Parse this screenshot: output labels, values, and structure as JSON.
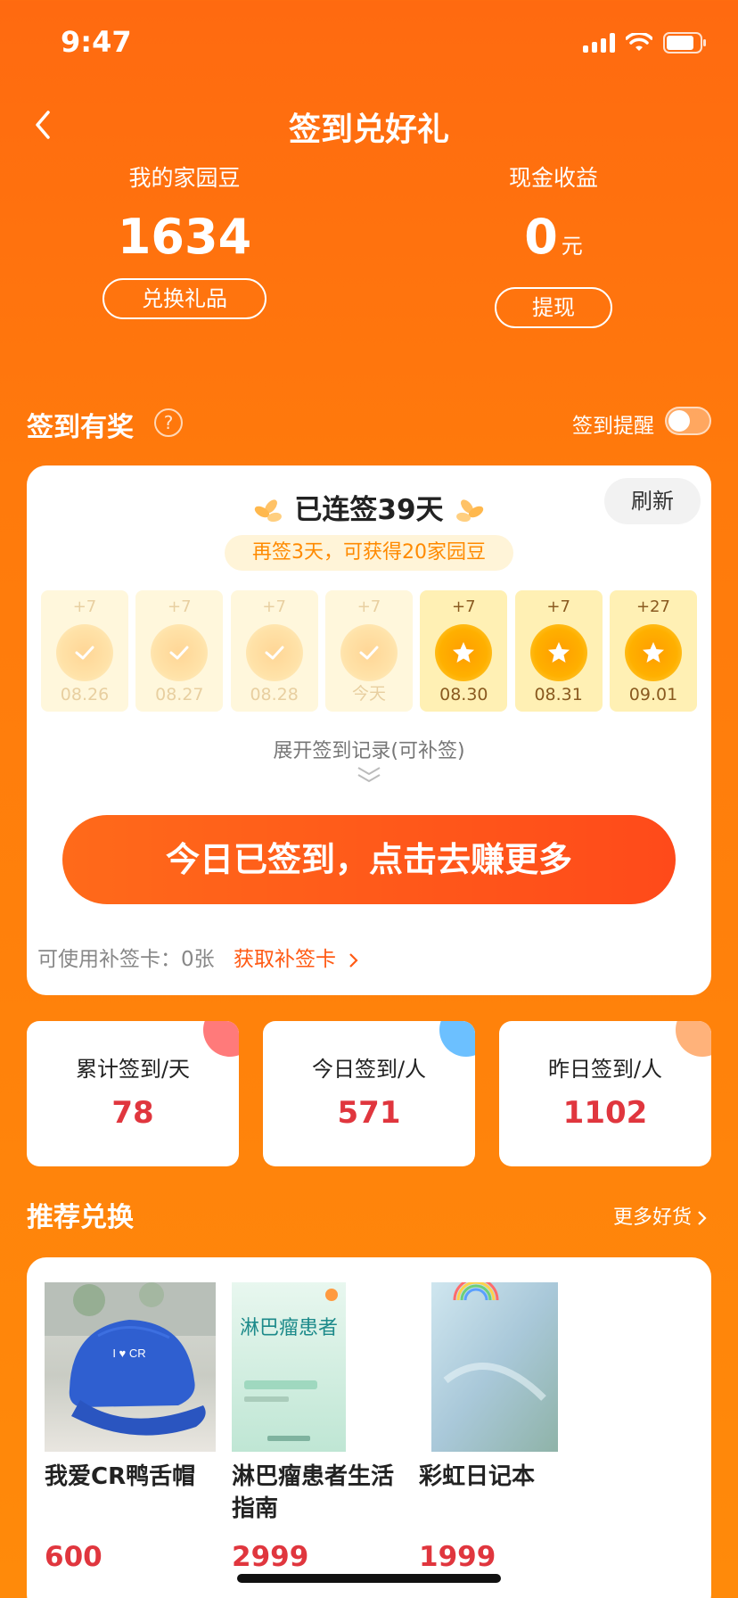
{
  "status": {
    "time": "9:47"
  },
  "nav": {
    "title": "签到兑好礼"
  },
  "beans": {
    "label": "我的家园豆",
    "value": "1634",
    "button": "兑换礼品"
  },
  "cash": {
    "label": "现金收益",
    "value": "0",
    "unit": "元",
    "button": "提现"
  },
  "signin": {
    "section_title": "签到有奖",
    "help": "?",
    "reminder_label": "签到提醒",
    "reminder_on": false,
    "streak_text": "已连签39天",
    "refresh": "刷新",
    "tip": "再签3天，可获得20家园豆",
    "days": [
      {
        "bonus": "+7",
        "date": "08.26",
        "state": "done"
      },
      {
        "bonus": "+7",
        "date": "08.27",
        "state": "done"
      },
      {
        "bonus": "+7",
        "date": "08.28",
        "state": "done"
      },
      {
        "bonus": "+7",
        "date": "今天",
        "state": "done"
      },
      {
        "bonus": "+7",
        "date": "08.30",
        "state": "future"
      },
      {
        "bonus": "+7",
        "date": "08.31",
        "state": "future"
      },
      {
        "bonus": "+27",
        "date": "09.01",
        "state": "future"
      }
    ],
    "expand_text": "展开签到记录(可补签)",
    "cta": "今日已签到，点击去赚更多",
    "makeup_label": "可使用补签卡：",
    "makeup_count": "0张",
    "makeup_link": "获取补签卡"
  },
  "stats": [
    {
      "label": "累计签到/天",
      "value": "78",
      "color": "#ff7a7a"
    },
    {
      "label": "今日签到/人",
      "value": "571",
      "color": "#6cc0ff"
    },
    {
      "label": "昨日签到/人",
      "value": "1102",
      "color": "#ffb27a"
    }
  ],
  "recommend": {
    "title": "推荐兑换",
    "more": "更多好货",
    "products": [
      {
        "name": "我爱CR鸭舌帽",
        "price": "600",
        "image": "blue-cap",
        "img_text": "I ♥ CR"
      },
      {
        "name": "淋巴瘤患者生活指南",
        "price": "2999",
        "image": "book-cover",
        "img_text": "淋巴瘤患者"
      },
      {
        "name": "彩虹日记本",
        "price": "1999",
        "image": "rainbow-notebook"
      }
    ]
  },
  "colors": {
    "accent": "#ff6a10",
    "price": "#e0363e",
    "coin": "#ffb000"
  }
}
